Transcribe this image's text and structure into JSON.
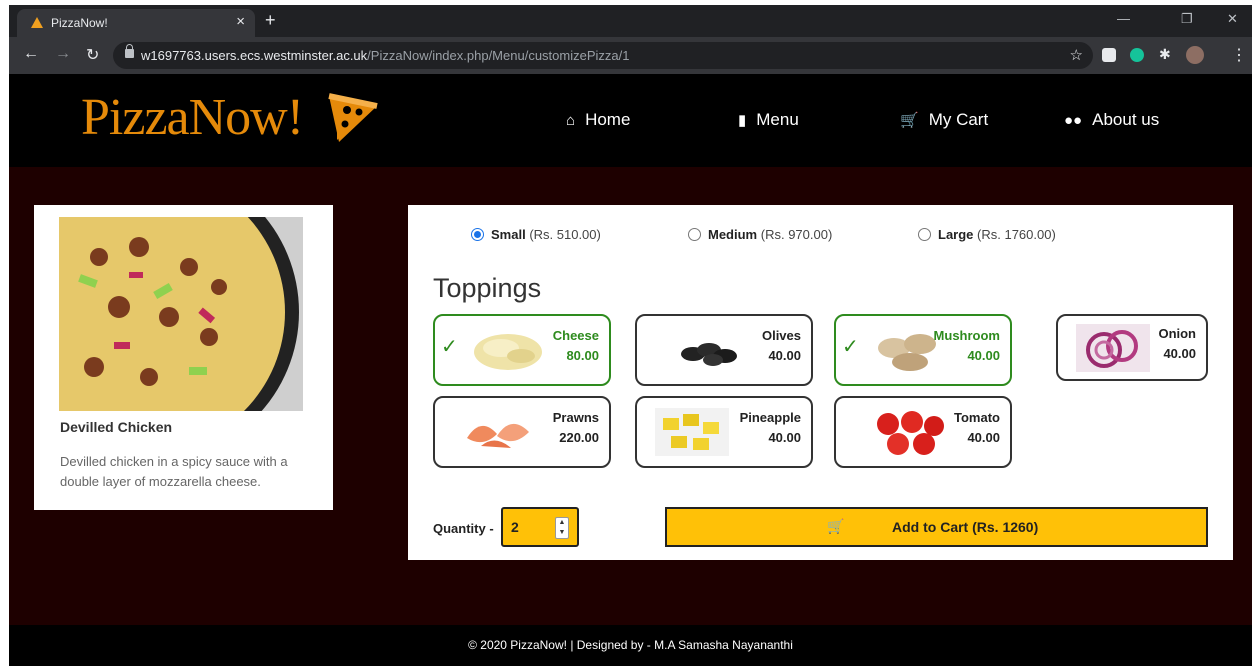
{
  "browser": {
    "tab_title": "PizzaNow!",
    "tab_close": "×",
    "new_tab": "+",
    "url_host": "w1697763.users.ecs.westminster.ac.uk",
    "url_path": "/PizzaNow/index.php/Menu/customizePizza/1"
  },
  "site": {
    "logo": "PizzaNow!",
    "nav": [
      {
        "label": "Home",
        "icon": "home-icon"
      },
      {
        "label": "Menu",
        "icon": "book-icon"
      },
      {
        "label": "My Cart",
        "icon": "cart-icon"
      },
      {
        "label": "About us",
        "icon": "users-icon"
      }
    ]
  },
  "pizza": {
    "name": "Devilled Chicken",
    "description": "Devilled chicken in a spicy sauce with a double layer of mozzarella cheese."
  },
  "sizes": [
    {
      "name": "Small",
      "price": "(Rs. 510.00)",
      "selected": true
    },
    {
      "name": "Medium",
      "price": "(Rs. 970.00)",
      "selected": false
    },
    {
      "name": "Large",
      "price": "(Rs. 1760.00)",
      "selected": false
    }
  ],
  "toppings_heading": "Toppings",
  "toppings": [
    {
      "name": "Cheese",
      "price": "80.00",
      "selected": true
    },
    {
      "name": "Olives",
      "price": "40.00",
      "selected": false
    },
    {
      "name": "Mushroom",
      "price": "40.00",
      "selected": true
    },
    {
      "name": "Onion",
      "price": "40.00",
      "selected": false
    },
    {
      "name": "Prawns",
      "price": "220.00",
      "selected": false
    },
    {
      "name": "Pineapple",
      "price": "40.00",
      "selected": false
    },
    {
      "name": "Tomato",
      "price": "40.00",
      "selected": false
    }
  ],
  "quantity": {
    "label": "Quantity -",
    "value": "2"
  },
  "add_to_cart": "Add to Cart (Rs. 1260)",
  "footer": "© 2020 PizzaNow! | Designed by - M.A Samasha Nayananthi",
  "colors": {
    "accent": "#ffc107",
    "selected": "#2e8b1e",
    "brand": "#e58a0a",
    "background": "#1e0000"
  }
}
